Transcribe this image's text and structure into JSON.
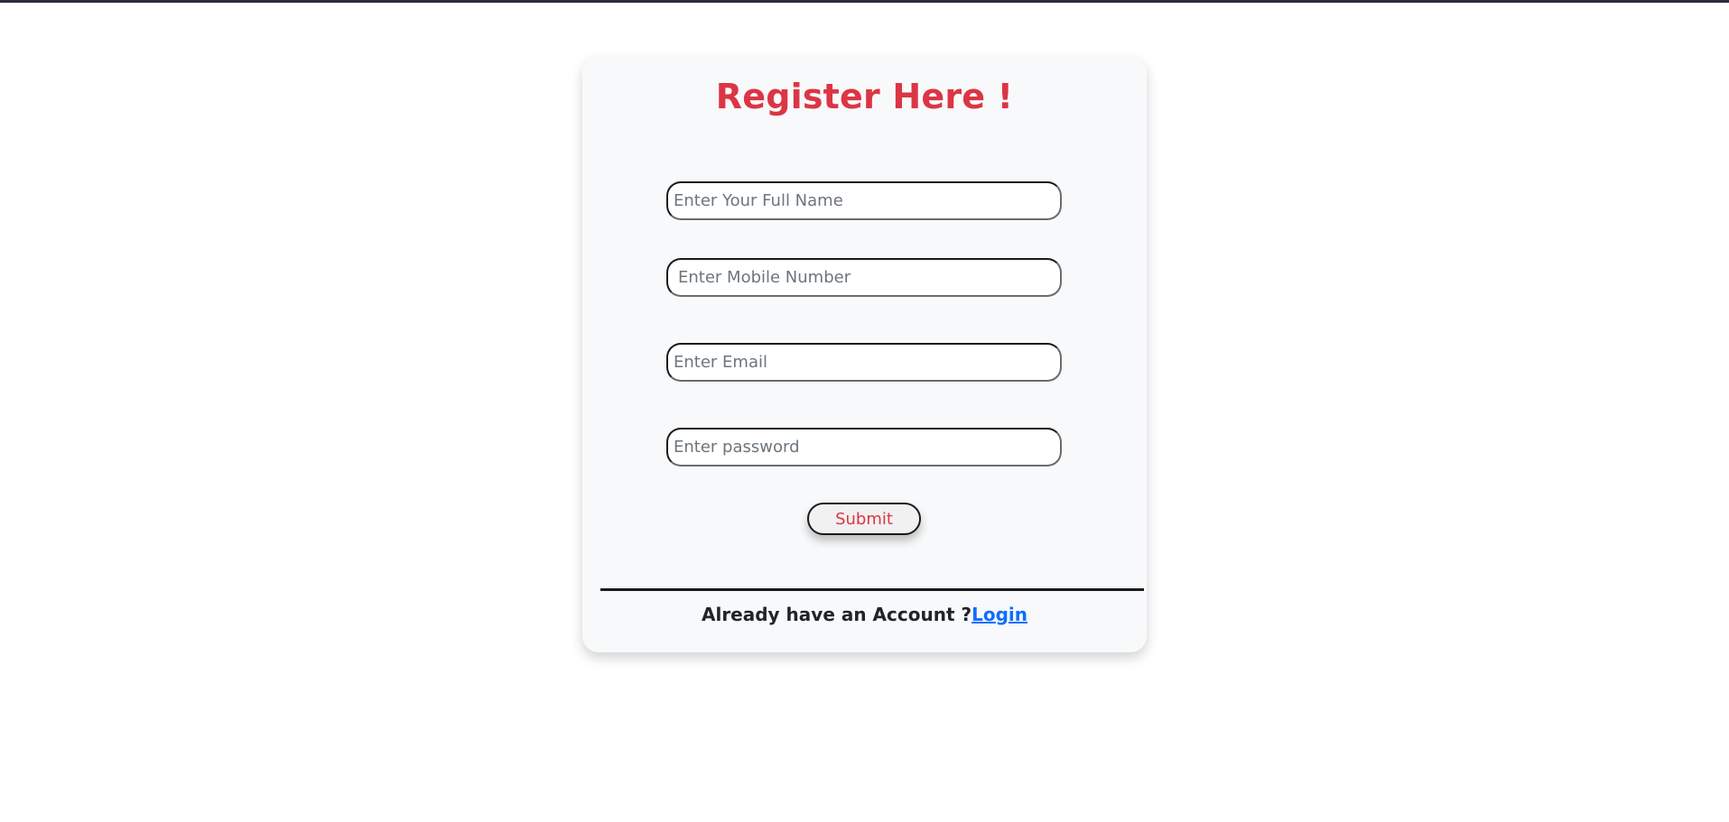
{
  "form": {
    "title": "Register Here !",
    "fields": {
      "full_name": {
        "placeholder": "Enter Your Full Name",
        "value": ""
      },
      "mobile": {
        "placeholder": "Enter Mobile Number",
        "value": ""
      },
      "email": {
        "placeholder": "Enter Email",
        "value": ""
      },
      "password": {
        "placeholder": "Enter password",
        "value": ""
      }
    },
    "submit_label": "Submit"
  },
  "footer": {
    "prompt_text": "Already have an Account ?",
    "login_label": "Login"
  },
  "colors": {
    "title": "#dc3545",
    "submit_text": "#dc3545",
    "link": "#0d6efd",
    "card_background": "#f8f9fa"
  }
}
